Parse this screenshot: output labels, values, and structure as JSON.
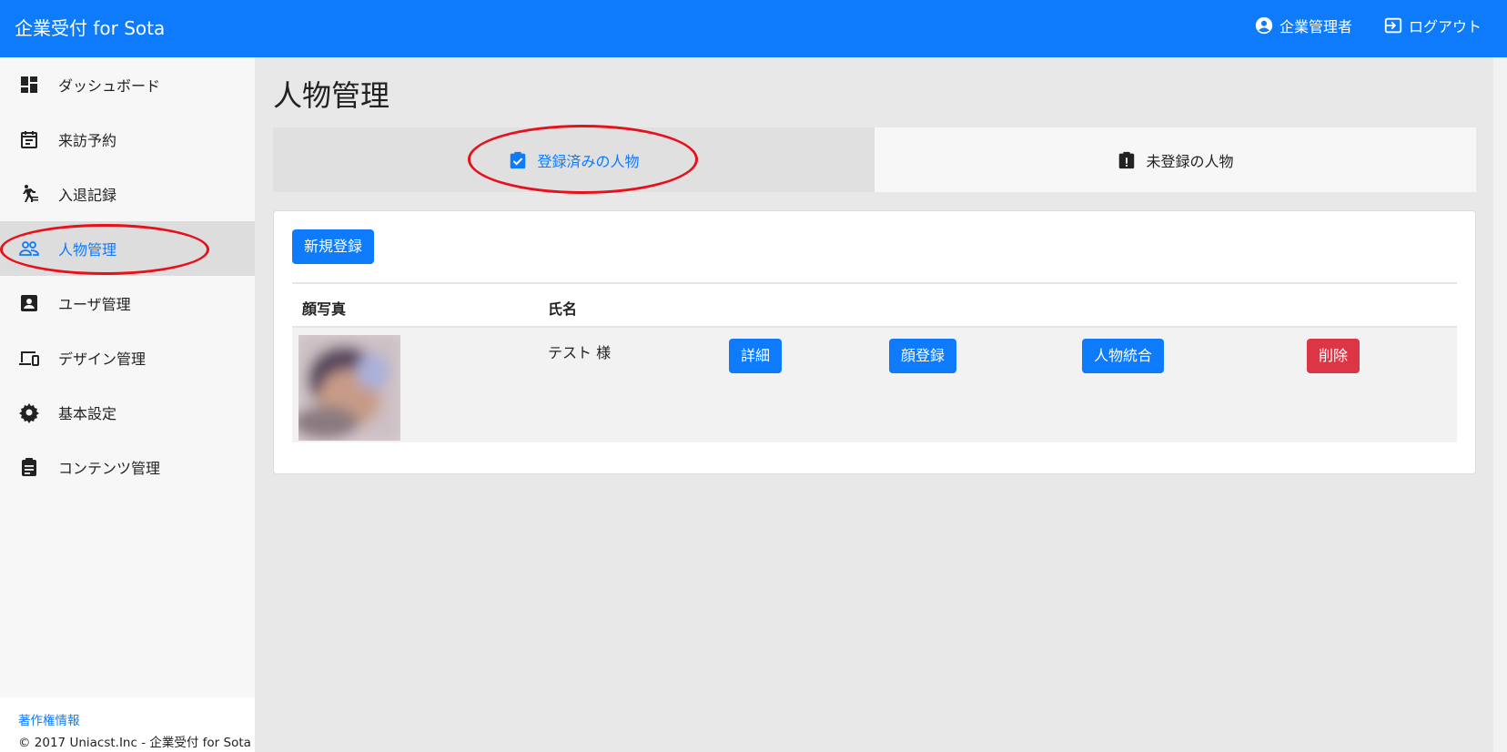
{
  "header": {
    "brand": "企業受付 for Sota",
    "user_label": "企業管理者",
    "logout_label": "ログアウト"
  },
  "sidebar": {
    "items": [
      {
        "label": "ダッシュボード",
        "icon": "dashboard-icon"
      },
      {
        "label": "来訪予約",
        "icon": "calendar-icon"
      },
      {
        "label": "入退記録",
        "icon": "walking-person-icon"
      },
      {
        "label": "人物管理",
        "icon": "people-icon"
      },
      {
        "label": "ユーザ管理",
        "icon": "user-badge-icon"
      },
      {
        "label": "デザイン管理",
        "icon": "devices-icon"
      },
      {
        "label": "基本設定",
        "icon": "gear-icon"
      },
      {
        "label": "コンテンツ管理",
        "icon": "clipboard-icon"
      }
    ],
    "active_index": 3,
    "footer": {
      "link": "著作権情報",
      "copyright": "© 2017 Uniacst.Inc - 企業受付 for Sota"
    }
  },
  "main": {
    "title": "人物管理",
    "tabs": [
      {
        "label": "登録済みの人物",
        "icon": "clipboard-check-icon",
        "active": true
      },
      {
        "label": "未登録の人物",
        "icon": "clipboard-alert-icon",
        "active": false
      }
    ],
    "new_button": "新規登録",
    "table": {
      "columns": [
        "顔写真",
        "氏名"
      ],
      "rows": [
        {
          "name": "テスト 様",
          "buttons": [
            "詳細",
            "顔登録",
            "人物統合",
            "削除"
          ]
        }
      ]
    }
  },
  "colors": {
    "primary": "#0d7bfb",
    "danger": "#dc3545",
    "annotation": "#e8101a"
  }
}
